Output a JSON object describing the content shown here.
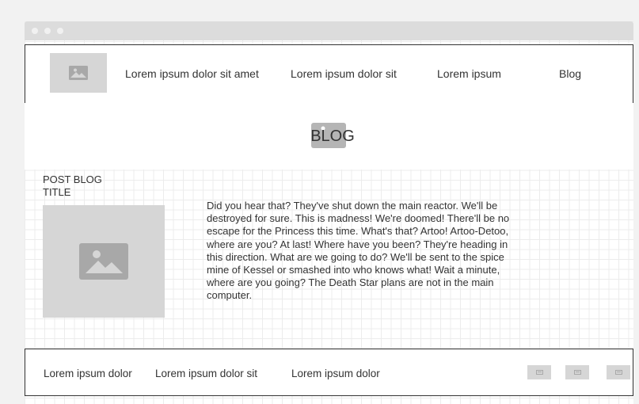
{
  "nav": {
    "logo_icon": "image-icon",
    "links": [
      "Lorem ipsum dolor sit amet",
      "Lorem ipsum dolor sit",
      "Lorem ipsum",
      "Blog"
    ]
  },
  "hero": {
    "title": "BLOG",
    "image_icon": "image-icon"
  },
  "post": {
    "title": "POST BLOG TITLE",
    "image_icon": "image-icon",
    "body": "Did you hear that? They've shut down the main reactor. We'll be destroyed for sure. This is madness! We're doomed! There'll be no escape for the Princess this time. What's that? Artoo! Artoo-Detoo, where are you? At last! Where have you been? They're heading in this direction. What are we going to do? We'll be sent to the spice mine of Kessel or smashed into who knows what! Wait a minute, where are you going? The Death Star plans are not in the main computer."
  },
  "footer": {
    "links": [
      "Lorem ipsum dolor",
      "Lorem ipsum dolor sit",
      "Lorem ipsum dolor"
    ],
    "social_icons": [
      "image-icon",
      "image-icon",
      "image-icon"
    ]
  },
  "colors": {
    "placeholder": "#d6d6d6",
    "icon": "#a8a8a8",
    "border": "#333333",
    "titlebar": "#dcdcdc"
  }
}
